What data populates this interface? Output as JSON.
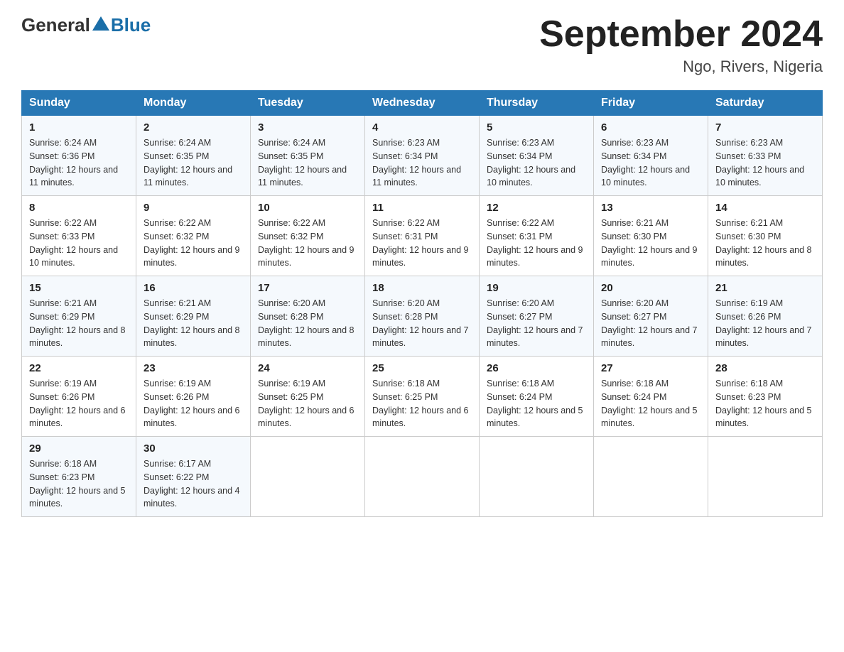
{
  "logo": {
    "text_general": "General",
    "text_blue": "Blue"
  },
  "title": "September 2024",
  "subtitle": "Ngo, Rivers, Nigeria",
  "days_of_week": [
    "Sunday",
    "Monday",
    "Tuesday",
    "Wednesday",
    "Thursday",
    "Friday",
    "Saturday"
  ],
  "weeks": [
    [
      {
        "day": "1",
        "sunrise": "Sunrise: 6:24 AM",
        "sunset": "Sunset: 6:36 PM",
        "daylight": "Daylight: 12 hours and 11 minutes."
      },
      {
        "day": "2",
        "sunrise": "Sunrise: 6:24 AM",
        "sunset": "Sunset: 6:35 PM",
        "daylight": "Daylight: 12 hours and 11 minutes."
      },
      {
        "day": "3",
        "sunrise": "Sunrise: 6:24 AM",
        "sunset": "Sunset: 6:35 PM",
        "daylight": "Daylight: 12 hours and 11 minutes."
      },
      {
        "day": "4",
        "sunrise": "Sunrise: 6:23 AM",
        "sunset": "Sunset: 6:34 PM",
        "daylight": "Daylight: 12 hours and 11 minutes."
      },
      {
        "day": "5",
        "sunrise": "Sunrise: 6:23 AM",
        "sunset": "Sunset: 6:34 PM",
        "daylight": "Daylight: 12 hours and 10 minutes."
      },
      {
        "day": "6",
        "sunrise": "Sunrise: 6:23 AM",
        "sunset": "Sunset: 6:34 PM",
        "daylight": "Daylight: 12 hours and 10 minutes."
      },
      {
        "day": "7",
        "sunrise": "Sunrise: 6:23 AM",
        "sunset": "Sunset: 6:33 PM",
        "daylight": "Daylight: 12 hours and 10 minutes."
      }
    ],
    [
      {
        "day": "8",
        "sunrise": "Sunrise: 6:22 AM",
        "sunset": "Sunset: 6:33 PM",
        "daylight": "Daylight: 12 hours and 10 minutes."
      },
      {
        "day": "9",
        "sunrise": "Sunrise: 6:22 AM",
        "sunset": "Sunset: 6:32 PM",
        "daylight": "Daylight: 12 hours and 9 minutes."
      },
      {
        "day": "10",
        "sunrise": "Sunrise: 6:22 AM",
        "sunset": "Sunset: 6:32 PM",
        "daylight": "Daylight: 12 hours and 9 minutes."
      },
      {
        "day": "11",
        "sunrise": "Sunrise: 6:22 AM",
        "sunset": "Sunset: 6:31 PM",
        "daylight": "Daylight: 12 hours and 9 minutes."
      },
      {
        "day": "12",
        "sunrise": "Sunrise: 6:22 AM",
        "sunset": "Sunset: 6:31 PM",
        "daylight": "Daylight: 12 hours and 9 minutes."
      },
      {
        "day": "13",
        "sunrise": "Sunrise: 6:21 AM",
        "sunset": "Sunset: 6:30 PM",
        "daylight": "Daylight: 12 hours and 9 minutes."
      },
      {
        "day": "14",
        "sunrise": "Sunrise: 6:21 AM",
        "sunset": "Sunset: 6:30 PM",
        "daylight": "Daylight: 12 hours and 8 minutes."
      }
    ],
    [
      {
        "day": "15",
        "sunrise": "Sunrise: 6:21 AM",
        "sunset": "Sunset: 6:29 PM",
        "daylight": "Daylight: 12 hours and 8 minutes."
      },
      {
        "day": "16",
        "sunrise": "Sunrise: 6:21 AM",
        "sunset": "Sunset: 6:29 PM",
        "daylight": "Daylight: 12 hours and 8 minutes."
      },
      {
        "day": "17",
        "sunrise": "Sunrise: 6:20 AM",
        "sunset": "Sunset: 6:28 PM",
        "daylight": "Daylight: 12 hours and 8 minutes."
      },
      {
        "day": "18",
        "sunrise": "Sunrise: 6:20 AM",
        "sunset": "Sunset: 6:28 PM",
        "daylight": "Daylight: 12 hours and 7 minutes."
      },
      {
        "day": "19",
        "sunrise": "Sunrise: 6:20 AM",
        "sunset": "Sunset: 6:27 PM",
        "daylight": "Daylight: 12 hours and 7 minutes."
      },
      {
        "day": "20",
        "sunrise": "Sunrise: 6:20 AM",
        "sunset": "Sunset: 6:27 PM",
        "daylight": "Daylight: 12 hours and 7 minutes."
      },
      {
        "day": "21",
        "sunrise": "Sunrise: 6:19 AM",
        "sunset": "Sunset: 6:26 PM",
        "daylight": "Daylight: 12 hours and 7 minutes."
      }
    ],
    [
      {
        "day": "22",
        "sunrise": "Sunrise: 6:19 AM",
        "sunset": "Sunset: 6:26 PM",
        "daylight": "Daylight: 12 hours and 6 minutes."
      },
      {
        "day": "23",
        "sunrise": "Sunrise: 6:19 AM",
        "sunset": "Sunset: 6:26 PM",
        "daylight": "Daylight: 12 hours and 6 minutes."
      },
      {
        "day": "24",
        "sunrise": "Sunrise: 6:19 AM",
        "sunset": "Sunset: 6:25 PM",
        "daylight": "Daylight: 12 hours and 6 minutes."
      },
      {
        "day": "25",
        "sunrise": "Sunrise: 6:18 AM",
        "sunset": "Sunset: 6:25 PM",
        "daylight": "Daylight: 12 hours and 6 minutes."
      },
      {
        "day": "26",
        "sunrise": "Sunrise: 6:18 AM",
        "sunset": "Sunset: 6:24 PM",
        "daylight": "Daylight: 12 hours and 5 minutes."
      },
      {
        "day": "27",
        "sunrise": "Sunrise: 6:18 AM",
        "sunset": "Sunset: 6:24 PM",
        "daylight": "Daylight: 12 hours and 5 minutes."
      },
      {
        "day": "28",
        "sunrise": "Sunrise: 6:18 AM",
        "sunset": "Sunset: 6:23 PM",
        "daylight": "Daylight: 12 hours and 5 minutes."
      }
    ],
    [
      {
        "day": "29",
        "sunrise": "Sunrise: 6:18 AM",
        "sunset": "Sunset: 6:23 PM",
        "daylight": "Daylight: 12 hours and 5 minutes."
      },
      {
        "day": "30",
        "sunrise": "Sunrise: 6:17 AM",
        "sunset": "Sunset: 6:22 PM",
        "daylight": "Daylight: 12 hours and 4 minutes."
      },
      null,
      null,
      null,
      null,
      null
    ]
  ]
}
